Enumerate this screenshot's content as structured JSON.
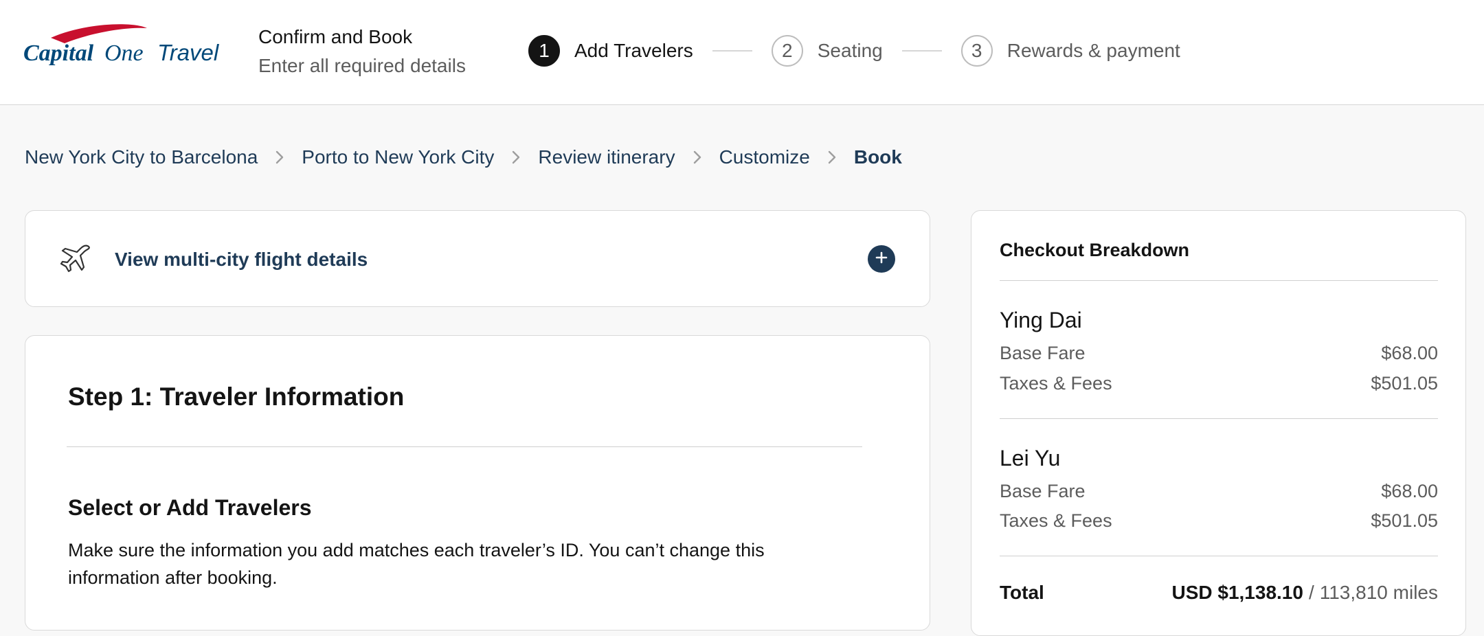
{
  "brand": {
    "logo_text_capital": "Capital",
    "logo_text_one": "One",
    "logo_text_travel": "Travel"
  },
  "header": {
    "title": "Confirm and Book",
    "subtitle": "Enter all required details"
  },
  "stepper": [
    {
      "number": "1",
      "label": "Add Travelers",
      "active": true
    },
    {
      "number": "2",
      "label": "Seating",
      "active": false
    },
    {
      "number": "3",
      "label": "Rewards & payment",
      "active": false
    }
  ],
  "breadcrumb": [
    "New York City to Barcelona",
    "Porto to New York City",
    "Review itinerary",
    "Customize",
    "Book"
  ],
  "flight_details": {
    "label": "View multi-city flight details",
    "icon": "airplane-icon",
    "expand_icon": "plus-icon"
  },
  "traveler_info": {
    "step_title": "Step 1: Traveler Information",
    "section_title": "Select or Add Travelers",
    "description": "Make sure the information you add matches each traveler’s ID. You can’t change this information after booking."
  },
  "checkout": {
    "title": "Checkout Breakdown",
    "travelers": [
      {
        "name": "Ying Dai",
        "base_fare_label": "Base Fare",
        "base_fare": "$68.00",
        "taxes_label": "Taxes & Fees",
        "taxes": "$501.05"
      },
      {
        "name": "Lei Yu",
        "base_fare_label": "Base Fare",
        "base_fare": "$68.00",
        "taxes_label": "Taxes & Fees",
        "taxes": "$501.05"
      }
    ],
    "total_label": "Total",
    "total_amount": "USD $1,138.10",
    "total_separator": "/",
    "total_miles": "113,810 miles"
  },
  "colors": {
    "navy": "#1f3b57",
    "brand_red": "#c8102e",
    "brand_blue": "#004879"
  }
}
